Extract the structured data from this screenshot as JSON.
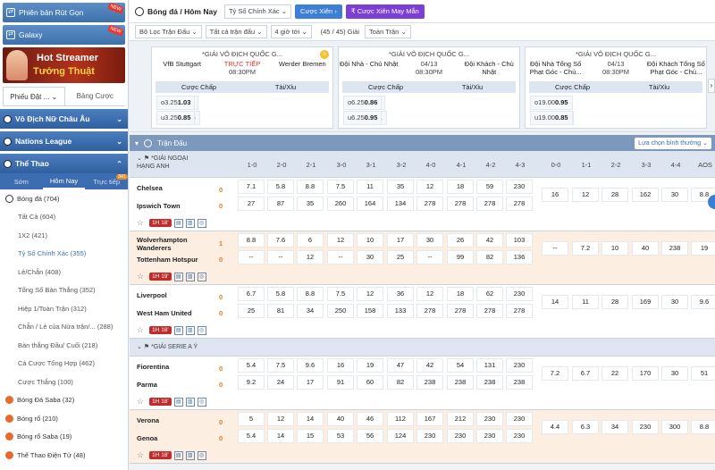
{
  "sidebar": {
    "btn_quick": "Phiên bản Rút Gọn",
    "btn_galaxy": "Galaxy",
    "new_badge": "NEW",
    "banner_l1": "Hot Streamer",
    "banner_l2": "Tướng Thuật",
    "tab_bets": "Phiếu Đặt ...",
    "tab_odds": "Bảng Cược",
    "cat_women": "Vô Địch Nữ Châu Âu",
    "cat_nations": "Nations League",
    "cat_sports": "Thể Thao",
    "sub_early": "Sớm",
    "sub_today": "Hôm Nay",
    "sub_live": "Trực tiếp",
    "sub_live_count": "341",
    "items": [
      {
        "label": "Bóng đá (704)"
      },
      {
        "label": "Tất Cả (604)"
      },
      {
        "label": "1X2 (421)"
      },
      {
        "label": "Tỷ Số Chính Xác (355)"
      },
      {
        "label": "Lẻ/Chẵn (408)"
      },
      {
        "label": "Tổng Số Bàn Thắng (352)"
      },
      {
        "label": "Hiệp 1/Toàn Trận (312)"
      },
      {
        "label": "Chẵn / Lẻ của Nửa trận/...  (288)"
      },
      {
        "label": "Bàn thắng Đầu/ Cuối (218)"
      },
      {
        "label": "Cá Cược Tổng Hợp (462)"
      },
      {
        "label": "Cược Thắng (100)"
      },
      {
        "label": "Bóng Đá Saba (32)"
      },
      {
        "label": "Bóng rổ (210)"
      },
      {
        "label": "Bóng rổ Saba (19)"
      },
      {
        "label": "Thể Thao Điện Tử (48)"
      }
    ]
  },
  "topbar": {
    "title": "Bóng đá / Hôm Nay",
    "market": "Tỷ Số Chính Xác",
    "parlay": "Cược Xiên",
    "lucky_parlay": "Cược Xiên May Mắn"
  },
  "filters": {
    "f1": "Bộ Lọc Trận Đấu",
    "f2": "Tất cả trận đấu",
    "f3": "4 giờ tới",
    "f4": "(45 / 45) Giải",
    "f5": "Toàn Trận"
  },
  "cards": [
    {
      "league": "*GIẢI VÔ ĐỊCH QUỐC G...",
      "home": "VfB Stuttgart",
      "mid1": "TRỰC TIẾP",
      "mid2": "08:30PM",
      "away": "Werder Bremen",
      "h1": "Cược Chấp",
      "h2": "Tài/Xỉu",
      "r1": [
        "H",
        "-0.75",
        "0.94",
        "o",
        "3.25",
        "1.03"
      ],
      "r2": [
        "A",
        "+0.75",
        "0.95",
        "u",
        "3.25",
        "0.85"
      ]
    },
    {
      "league": "*GIẢI VÔ ĐỊCH QUỐC G...",
      "home": "Đội Nhà - Chủ Nhật",
      "mid1": "04/13",
      "mid2": "08:30PM",
      "away": "Đội Khách - Chủ Nhật",
      "h1": "Cược Chấp",
      "h2": "Tài/Xỉu",
      "r1": [
        "H",
        "-1.75",
        "1.02",
        "o",
        "6.25",
        "0.86"
      ],
      "r2": [
        "A",
        "+1.75",
        "0.81",
        "u",
        "6.25",
        "0.95"
      ]
    },
    {
      "league": "*GIẢI VÔ ĐỊCH QUỐC G...",
      "home": "Đội Nhà Tổng Số Phạt Góc - Chủ...",
      "mid1": "04/13",
      "mid2": "08:30PM",
      "away": "Đội Khách Tổng Số Phạt Góc - Chủ...",
      "h1": "Cược Chấp",
      "h2": "Tài/Xỉu",
      "r1": [
        "H",
        "-3.00",
        "0.87",
        "o",
        "19.00",
        "0.95"
      ],
      "r2": [
        "A",
        "+3.00",
        "0.92",
        "u",
        "19.00",
        "0.85"
      ]
    }
  ],
  "table": {
    "section": "Trận Đấu",
    "sort": "Lựa chọn bình thường",
    "columns": [
      "1-0",
      "2-0",
      "2-1",
      "3-0",
      "3-1",
      "3-2",
      "4-0",
      "4-1",
      "4-2",
      "4-3",
      "0-0",
      "1-1",
      "2-2",
      "3-3",
      "4-4",
      "AOS"
    ],
    "leagues": [
      {
        "name": "*GIẢI NGOẠI HẠNG ANH",
        "matches": [
          {
            "home": "Chelsea",
            "away": "Ipswich Town",
            "hs": "0",
            "as": "0",
            "time": "1H 18'",
            "top": [
              "7.1",
              "5.8",
              "8.8",
              "7.5",
              "11",
              "35",
              "12",
              "18",
              "59",
              "230"
            ],
            "bot": [
              "27",
              "87",
              "35",
              "260",
              "164",
              "134",
              "278",
              "278",
              "278",
              "278"
            ],
            "draws": [
              "16",
              "12",
              "28",
              "162",
              "30",
              "8.8"
            ]
          },
          {
            "home": "Wolverhampton Wanderers",
            "away": "Tottenham Hotspur",
            "hs": "1",
            "as": "0",
            "time": "1H 19'",
            "top": [
              "8.8",
              "7.6",
              "6",
              "12",
              "10",
              "17",
              "30",
              "26",
              "42",
              "103"
            ],
            "bot": [
              "--",
              "--",
              "12",
              "--",
              "30",
              "25",
              "--",
              "99",
              "82",
              "136"
            ],
            "draws": [
              "--",
              "7.2",
              "10",
              "40",
              "238",
              "19"
            ]
          },
          {
            "home": "Liverpool",
            "away": "West Ham United",
            "hs": "0",
            "as": "0",
            "time": "1H 18'",
            "top": [
              "6.7",
              "5.8",
              "8.8",
              "7.5",
              "12",
              "36",
              "12",
              "18",
              "62",
              "230"
            ],
            "bot": [
              "25",
              "81",
              "34",
              "250",
              "158",
              "133",
              "278",
              "278",
              "278",
              "278"
            ],
            "draws": [
              "14",
              "11",
              "28",
              "169",
              "30",
              "9.6"
            ]
          }
        ]
      },
      {
        "name": "*GIẢI SERIE A Ý",
        "matches": [
          {
            "home": "Fiorentina",
            "away": "Parma",
            "hs": "0",
            "as": "0",
            "time": "1H 18'",
            "top": [
              "5.4",
              "7.5",
              "9.6",
              "16",
              "19",
              "47",
              "42",
              "54",
              "131",
              "230"
            ],
            "bot": [
              "9.2",
              "24",
              "17",
              "91",
              "60",
              "82",
              "238",
              "238",
              "238",
              "238"
            ],
            "draws": [
              "7.2",
              "6.7",
              "22",
              "170",
              "30",
              "51"
            ]
          },
          {
            "home": "Verona",
            "away": "Genoa",
            "hs": "0",
            "as": "0",
            "time": "1H 18'",
            "top": [
              "5",
              "12",
              "14",
              "40",
              "46",
              "112",
              "167",
              "212",
              "230",
              "230"
            ],
            "bot": [
              "5.4",
              "14",
              "15",
              "53",
              "56",
              "124",
              "230",
              "230",
              "230",
              "230"
            ],
            "draws": [
              "4.4",
              "6.3",
              "34",
              "230",
              "300",
              "8.8"
            ]
          }
        ]
      }
    ]
  }
}
